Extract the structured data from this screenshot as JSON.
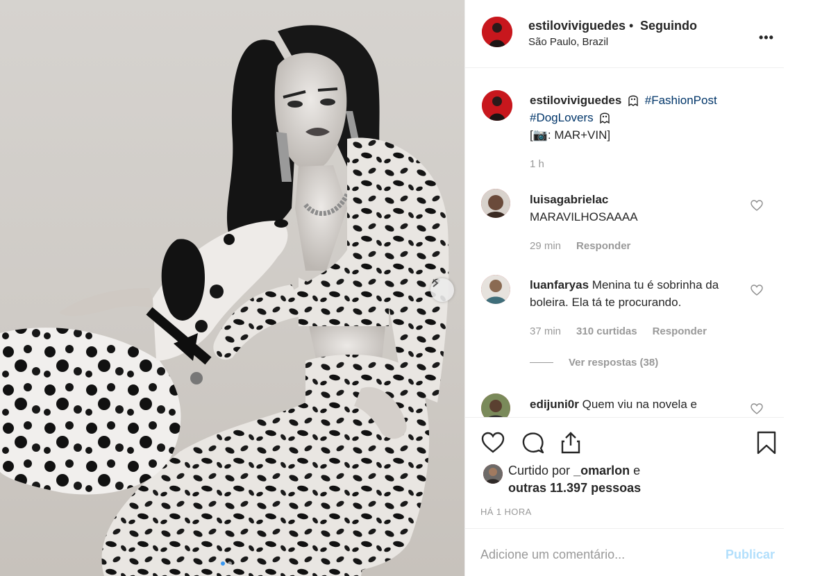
{
  "post_header": {
    "username": "estiloviviguedes",
    "separator": "•",
    "follow_status": "Seguindo",
    "location": "São Paulo, Brazil"
  },
  "caption": {
    "username": "estiloviviguedes",
    "hashtag1": "#FashionPost",
    "hashtag2": "#DogLovers",
    "credit": "[📷: MAR+VIN]",
    "time": "1 h"
  },
  "comments": [
    {
      "username": "luisagabrielac",
      "text": "MARAVILHOSAAAA",
      "time": "29 min",
      "likes": "",
      "reply_label": "Responder"
    },
    {
      "username": "luanfaryas",
      "text": "Menina tu é sobrinha da boleira. Ela tá te procurando.",
      "time": "37 min",
      "likes": "310 curtidas",
      "reply_label": "Responder"
    },
    {
      "username": "edijuni0r",
      "text": "Quem viu na novela e"
    }
  ],
  "view_replies": "Ver respostas (38)",
  "likes": {
    "prefix": "Curtido por",
    "user": "_omarlon",
    "conj": "e",
    "others": "outras 11.397 pessoas"
  },
  "posted_time": "HÁ 1 HORA",
  "composer": {
    "placeholder": "Adicione um comentário...",
    "publish_label": "Publicar"
  },
  "carousel": {
    "total": 2,
    "current": 1
  },
  "icons": {
    "more": "more-options-icon",
    "heart": "heart-icon",
    "comment": "comment-icon",
    "share": "share-icon",
    "save": "bookmark-icon",
    "next": "chevron-right-icon",
    "ghost": "ghost-emoji"
  },
  "colors": {
    "text": "#262626",
    "muted": "#999999",
    "hashtag": "#003569",
    "publish_disabled": "#b2dffc",
    "border": "#efefef"
  }
}
